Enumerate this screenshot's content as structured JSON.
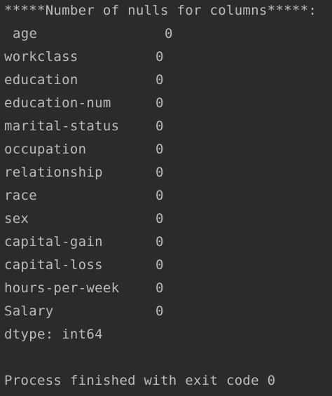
{
  "console": {
    "header": "*****Number of nulls for columns*****:",
    "rows": [
      {
        "name": "age",
        "value": "0"
      },
      {
        "name": "workclass",
        "value": "0"
      },
      {
        "name": "education",
        "value": "0"
      },
      {
        "name": "education-num",
        "value": "0"
      },
      {
        "name": "marital-status",
        "value": "0"
      },
      {
        "name": "occupation",
        "value": "0"
      },
      {
        "name": "relationship",
        "value": "0"
      },
      {
        "name": "race",
        "value": "0"
      },
      {
        "name": "sex",
        "value": "0"
      },
      {
        "name": "capital-gain",
        "value": "0"
      },
      {
        "name": "capital-loss",
        "value": "0"
      },
      {
        "name": "hours-per-week",
        "value": "0"
      },
      {
        "name": "Salary",
        "value": "0"
      }
    ],
    "dtype": "dtype: int64",
    "exit_message": "Process finished with exit code 0"
  }
}
